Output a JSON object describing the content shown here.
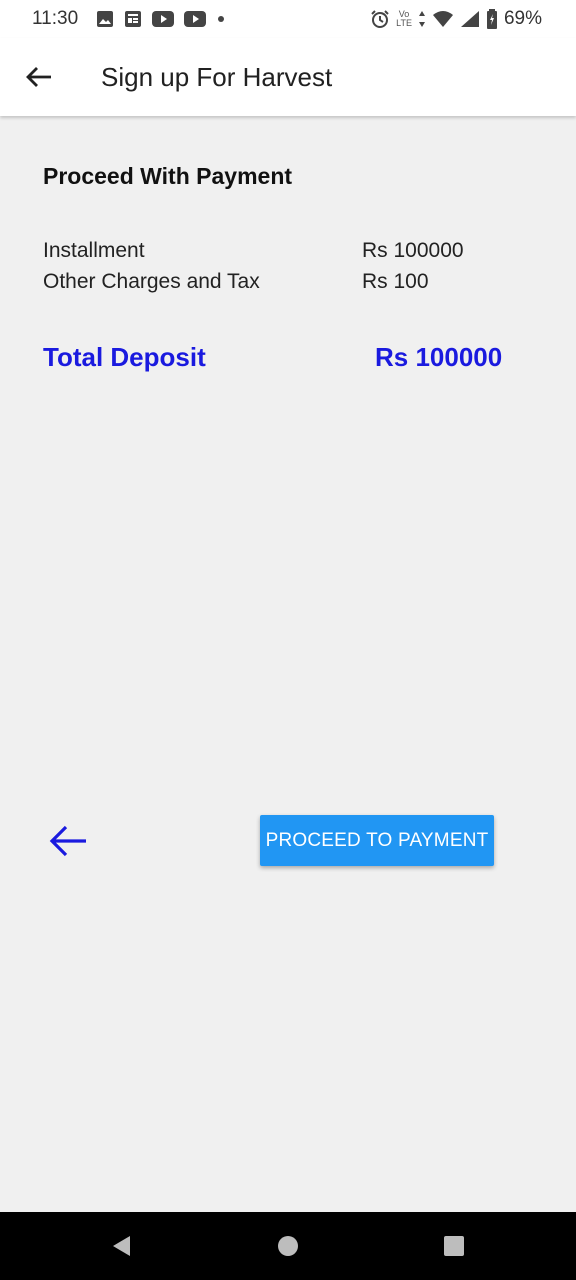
{
  "status_bar": {
    "time": "11:30",
    "battery_percent": "69%",
    "network_top": "Vo",
    "network_bottom": "LTE",
    "left_icons": [
      "image-icon",
      "news-icon",
      "youtube-icon",
      "youtube-icon",
      "dot-icon"
    ],
    "right_icons": [
      "alarm-icon",
      "volte-icon",
      "data-arrows-icon",
      "wifi-icon",
      "signal-icon",
      "battery-icon"
    ]
  },
  "app_bar": {
    "title": "Sign up For Harvest",
    "back_icon": "arrow-back-icon"
  },
  "payment": {
    "section_title": "Proceed With Payment",
    "rows": [
      {
        "label": "Installment",
        "value": "Rs 100000"
      },
      {
        "label": "Other Charges and Tax",
        "value": "Rs 100"
      }
    ],
    "total": {
      "label": "Total Deposit",
      "value": "Rs 100000"
    }
  },
  "actions": {
    "back_icon": "arrow-back-icon",
    "proceed_label": "PROCEED TO PAYMENT"
  },
  "nav_bar": {
    "icons": [
      "nav-back-icon",
      "nav-home-icon",
      "nav-recents-icon"
    ]
  },
  "colors": {
    "accent_text": "#1a1adf",
    "button": "#2196f3",
    "background": "#f0f0f0"
  }
}
